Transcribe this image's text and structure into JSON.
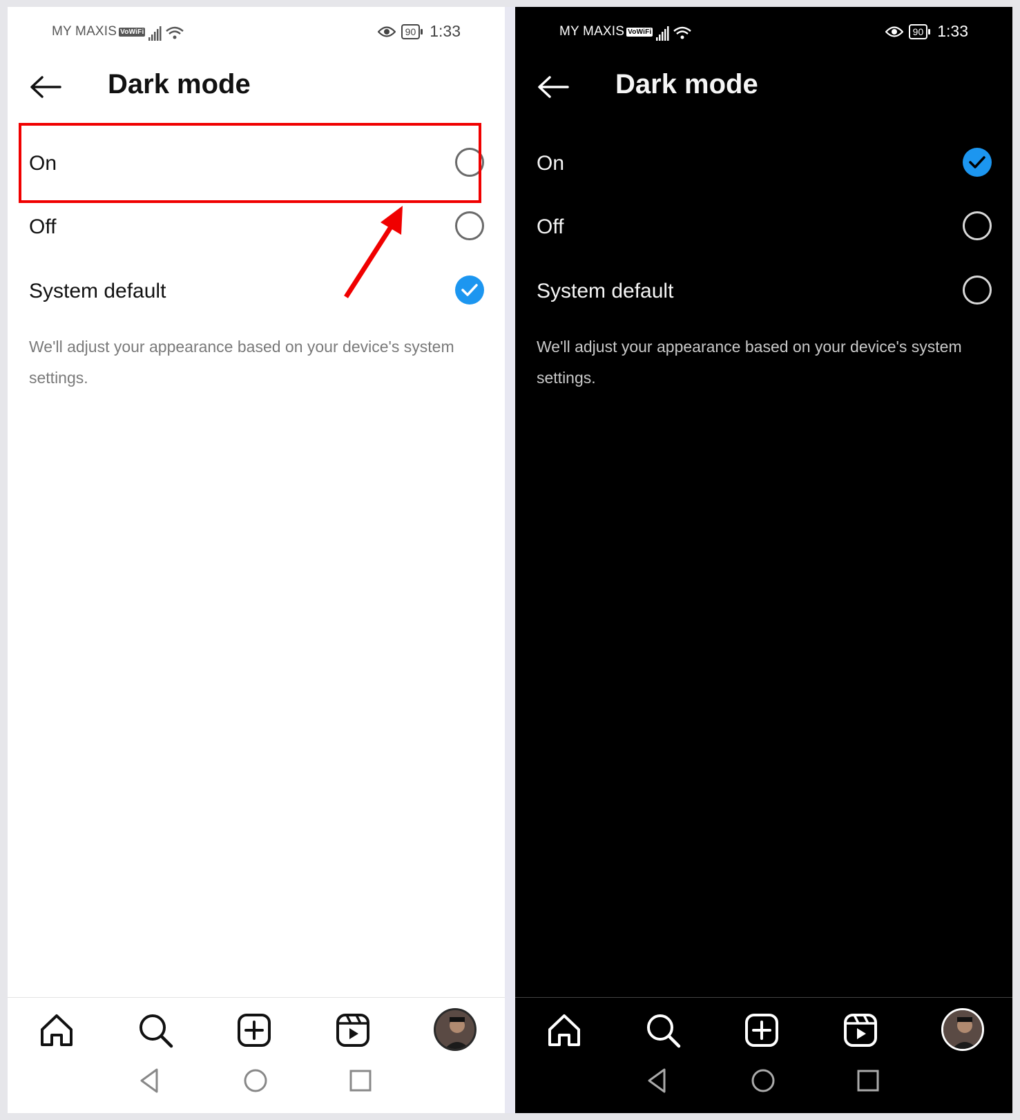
{
  "status_bar": {
    "carrier": "MY MAXIS",
    "vowifi": "VoWiFi",
    "battery": "90",
    "time": "1:33"
  },
  "header": {
    "title": "Dark mode"
  },
  "options": [
    {
      "label": "On"
    },
    {
      "label": "Off"
    },
    {
      "label": "System default"
    }
  ],
  "description": "We'll adjust your appearance based on your device's system settings.",
  "panels": {
    "light": {
      "selected": "System default",
      "background": "#ffffff"
    },
    "dark": {
      "selected": "On",
      "background": "#000000"
    }
  },
  "colors": {
    "accent": "#1c96f0",
    "highlight": "#f00000"
  },
  "bottom_nav": [
    "home-icon",
    "search-icon",
    "create-icon",
    "reels-icon",
    "profile-avatar"
  ],
  "system_nav": [
    "back-triangle-icon",
    "home-circle-icon",
    "recents-square-icon"
  ]
}
